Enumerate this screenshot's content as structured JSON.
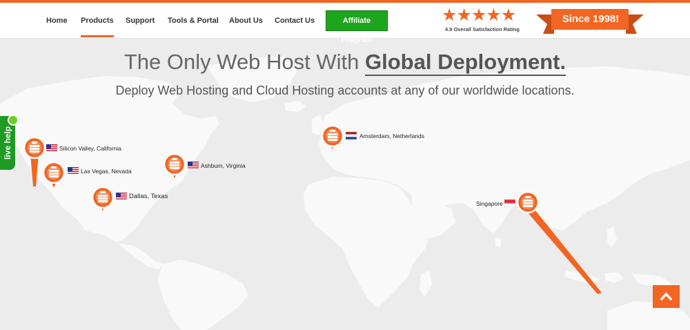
{
  "header": {
    "nav": [
      {
        "label": "Home",
        "active": false
      },
      {
        "label": "Products",
        "active": true
      },
      {
        "label": "Support",
        "active": false
      },
      {
        "label": "Tools & Portal",
        "active": false
      },
      {
        "label": "About Us",
        "active": false
      },
      {
        "label": "Contact Us",
        "active": false
      }
    ],
    "affiliate_label": "Affiliate Program",
    "stars": 5,
    "rating_text": "4.9 Overall Satisfaction Rating",
    "since_text": "Since 1998!",
    "accent_color": "#f26522",
    "affiliate_color": "#1ea51e"
  },
  "hero": {
    "headline_plain": "The Only Web Host With",
    "headline_strong": "Global Deployment.",
    "subhead": "Deploy Web Hosting and Cloud Hosting accounts at any of our worldwide locations."
  },
  "locations": [
    {
      "name": "Silicon Valley, California",
      "flag": "us-flag"
    },
    {
      "name": "Las Vegas, Nevada",
      "flag": "us-flag"
    },
    {
      "name": "Ashburn, Virginia",
      "flag": "us-flag"
    },
    {
      "name": "Dallas, Texas",
      "flag": "us-flag"
    },
    {
      "name": "Amsterdam, Netherlands",
      "flag": "netherlands-flag"
    },
    {
      "name": "Singapore",
      "flag": "singapore-flag"
    }
  ],
  "live_help_label": "live help",
  "scroll_top_icon": "chevron-up-icon"
}
